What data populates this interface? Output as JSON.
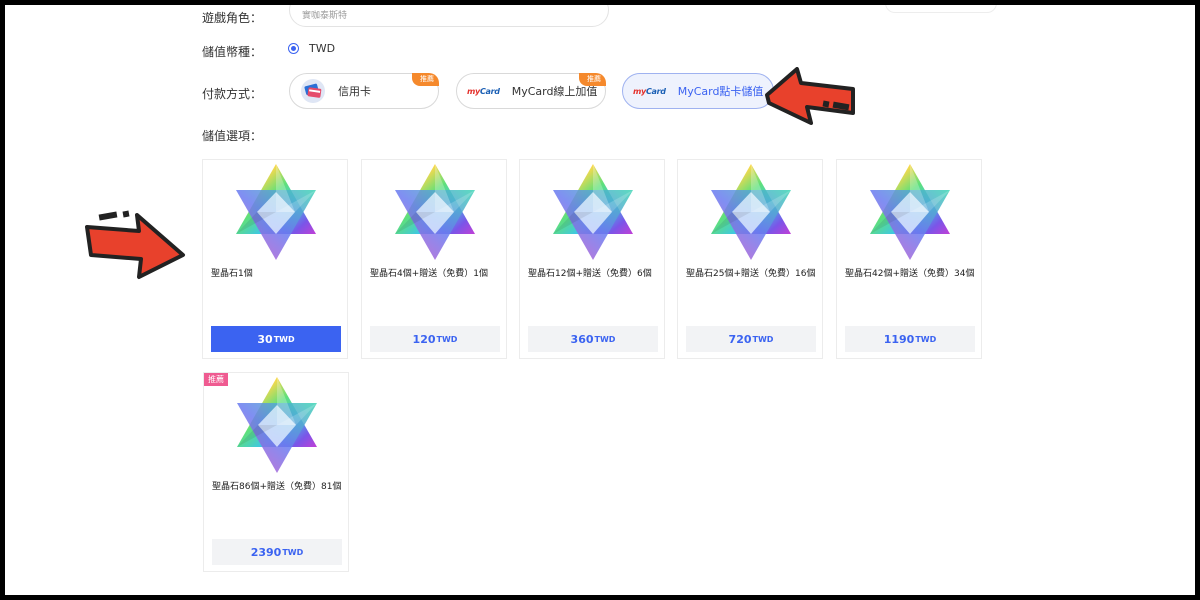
{
  "form": {
    "character_label": "遊戲角色：",
    "character_value": "實咖泰斯特",
    "currency_label": "儲值幣種：",
    "currency_value": "TWD",
    "payment_label": "付款方式：",
    "options_label": "儲值選項："
  },
  "payments": [
    {
      "label": "信用卡",
      "tag": "推薦",
      "icon": "credit-card-icon"
    },
    {
      "label": "MyCard線上加值",
      "tag": "推薦",
      "icon": "mycard-logo",
      "logo": "MyCard"
    },
    {
      "label": "MyCard點卡儲值",
      "icon": "mycard-logo",
      "logo": "MyCard",
      "selected": true
    }
  ],
  "products": [
    {
      "name": "聖晶石1個",
      "price": "30",
      "unit": "TWD",
      "selected": true
    },
    {
      "name": "聖晶石4個+贈送（免費）1個",
      "price": "120",
      "unit": "TWD"
    },
    {
      "name": "聖晶石12個+贈送（免費）6個",
      "price": "360",
      "unit": "TWD"
    },
    {
      "name": "聖晶石25個+贈送（免費）16個",
      "price": "720",
      "unit": "TWD"
    },
    {
      "name": "聖晶石42個+贈送（免費）34個",
      "price": "1190",
      "unit": "TWD"
    },
    {
      "name": "聖晶石86個+贈送（免費）81個",
      "price": "2390",
      "unit": "TWD",
      "badge": "推薦"
    }
  ],
  "colors": {
    "accent": "#3b63f1",
    "tag_orange": "#f5892c",
    "badge_pink": "#ef5b91",
    "arrow_red": "#e8412c"
  }
}
